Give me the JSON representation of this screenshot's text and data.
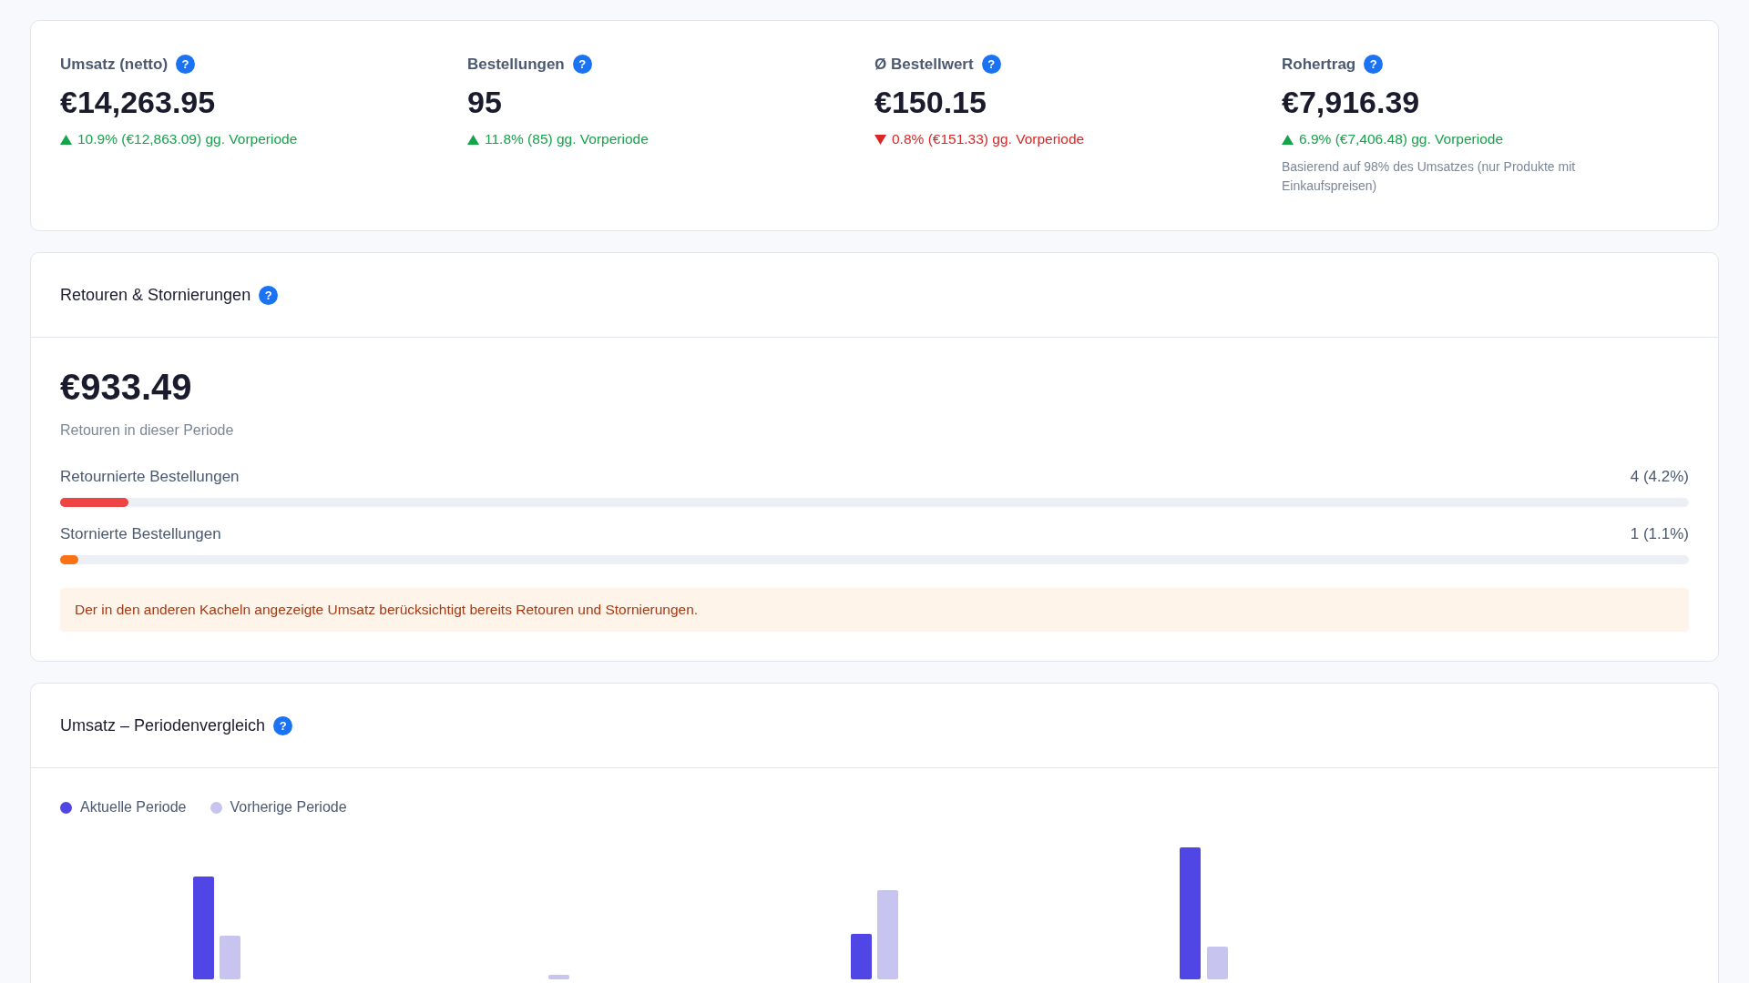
{
  "metrics": [
    {
      "label": "Umsatz (netto)",
      "help": "?",
      "value": "€14,263.95",
      "rising": true,
      "change": "10.9% (€12,863.09) gg. Vorperiode"
    },
    {
      "label": "Bestellungen",
      "help": "?",
      "value": "95",
      "rising": true,
      "change": "11.8% (85) gg. Vorperiode"
    },
    {
      "label": "Ø Bestellwert",
      "help": "?",
      "value": "€150.15",
      "rising": false,
      "change": "0.8% (€151.33) gg. Vorperiode"
    },
    {
      "label": "Rohertrag",
      "help": "?",
      "value": "€7,916.39",
      "rising": true,
      "change": "6.9% (€7,406.48) gg. Vorperiode",
      "note": "Basierend auf 98% des Umsatzes (nur Produkte mit Einkaufspreisen)"
    }
  ],
  "returns": {
    "title": "Retouren & Stornierungen",
    "help": "?",
    "amount": "€933.49",
    "caption": "Retouren in dieser Periode",
    "rows": [
      {
        "label": "Retournierte Bestellungen",
        "reading": "4 (4.2%)",
        "level": 0.042,
        "color": "#ef4444"
      },
      {
        "label": "Stornierte Bestellungen",
        "reading": "1 (1.1%)",
        "level": 0.011,
        "color": "#f97316"
      }
    ],
    "notice": "Der in den anderen Kacheln angezeigte Umsatz berücksichtigt bereits Retouren und Stornierungen."
  },
  "comparison": {
    "title": "Umsatz – Periodenvergleich",
    "help": "?",
    "legend": [
      {
        "label": "Aktuelle Periode",
        "color": "#4f46e5"
      },
      {
        "label": "Vorherige Periode",
        "color": "#c7c4f0"
      }
    ]
  }
}
